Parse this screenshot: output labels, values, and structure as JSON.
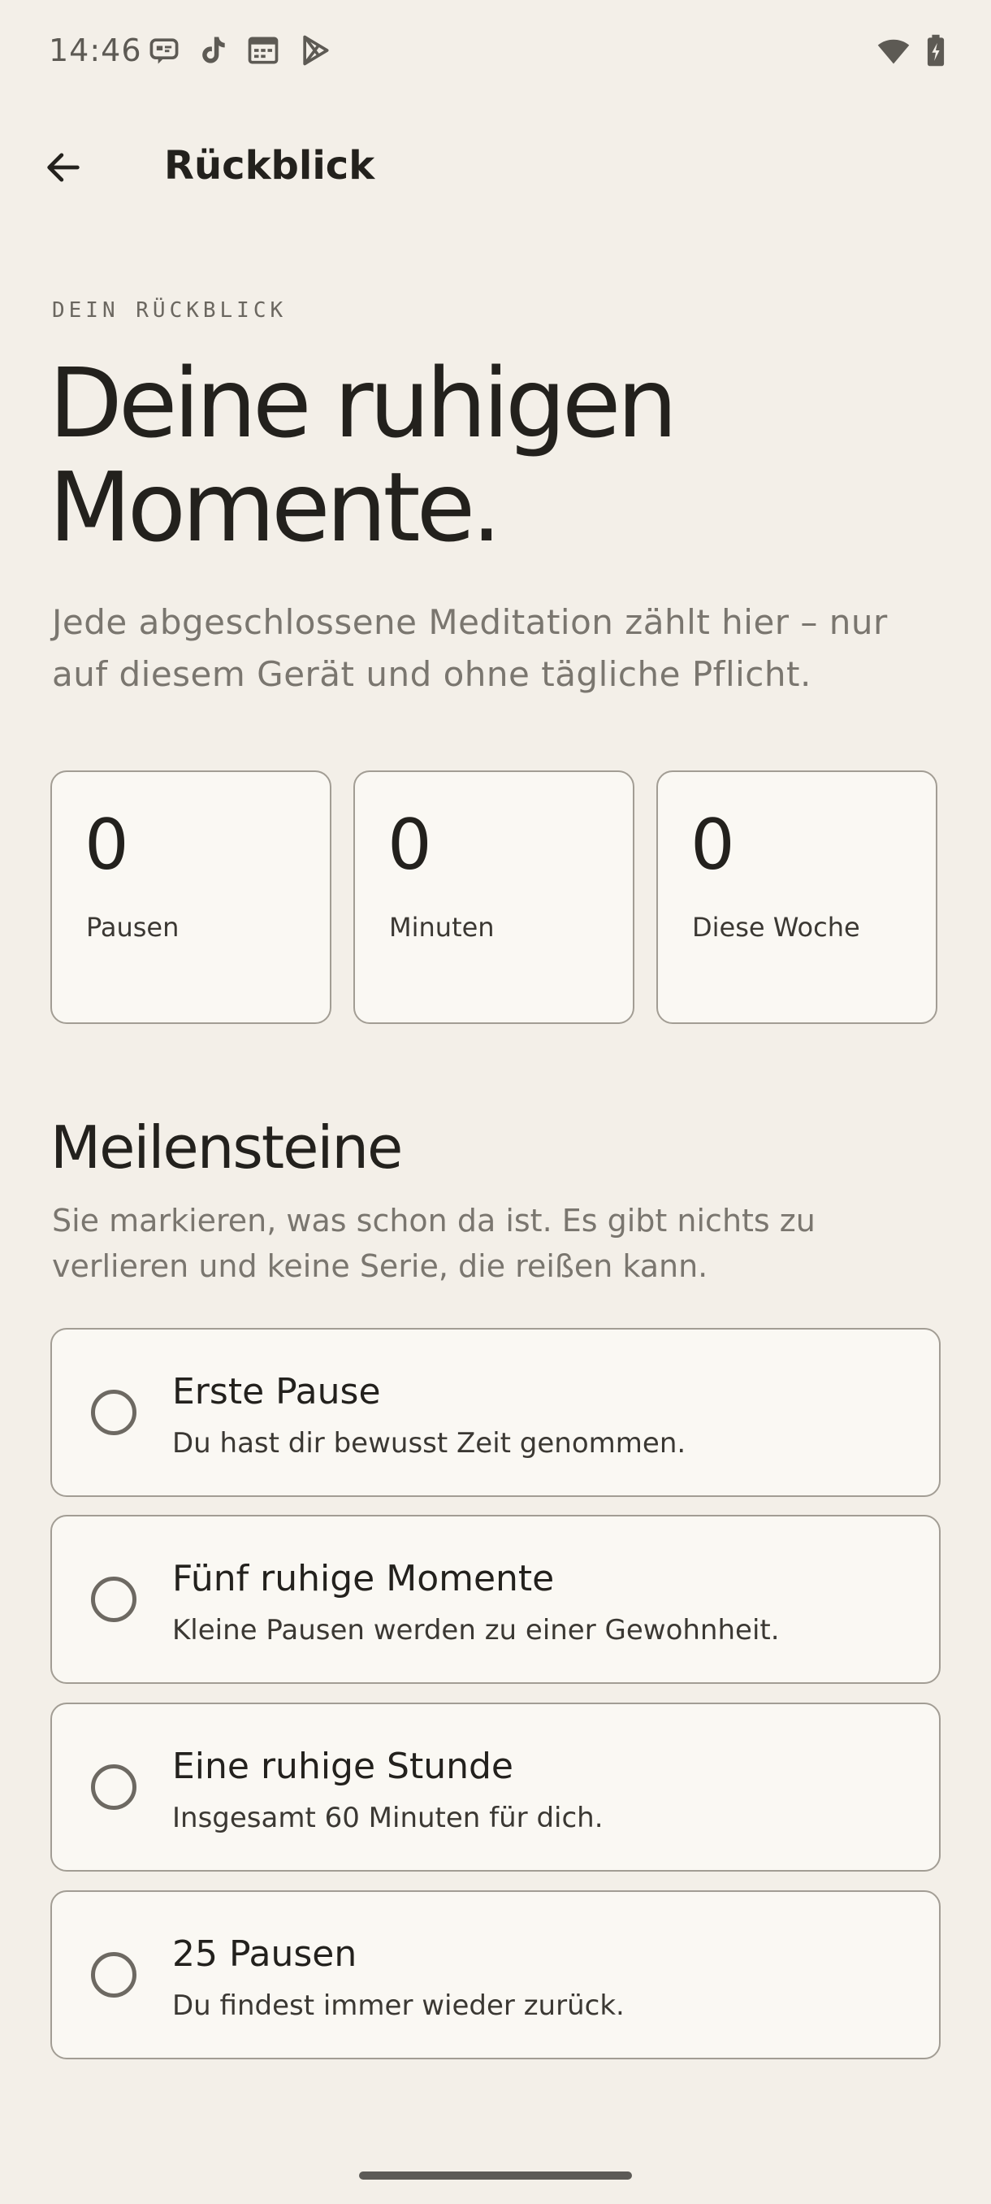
{
  "status_bar": {
    "time": "14:46",
    "notification_icons": [
      "message-icon",
      "tiktok-icon",
      "calendar-icon",
      "play-store-icon"
    ],
    "system_icons": [
      "wifi-icon",
      "battery-charging-icon"
    ]
  },
  "app_bar": {
    "back_icon": "arrow-left-icon",
    "title": "Rückblick"
  },
  "hero": {
    "eyebrow": "DEIN RÜCKBLICK",
    "headline_line1": "Deine ruhigen",
    "headline_line2": "Momente.",
    "intro": "Jede abgeschlossene Meditation zählt hier – nur auf diesem Gerät und ohne tägliche Pflicht."
  },
  "stats": [
    {
      "value": "0",
      "label": "Pausen"
    },
    {
      "value": "0",
      "label": "Minuten"
    },
    {
      "value": "0",
      "label": "Diese Woche"
    }
  ],
  "milestones": {
    "title": "Meilensteine",
    "subtitle": "Sie markieren, was schon da ist. Es gibt nichts zu verlieren und keine Serie, die reißen kann.",
    "items": [
      {
        "title": "Erste Pause",
        "description": "Du hast dir bewusst Zeit genommen.",
        "achieved": false
      },
      {
        "title": "Fünf ruhige Momente",
        "description": "Kleine Pausen werden zu einer Gewohnheit.",
        "achieved": false
      },
      {
        "title": "Eine ruhige Stunde",
        "description": "Insgesamt 60 Minuten für dich.",
        "achieved": false
      },
      {
        "title": "25 Pausen",
        "description": "Du findest immer wieder zurück.",
        "achieved": false
      }
    ]
  },
  "colors": {
    "background": "#f3efe8",
    "card_background": "#faf8f3",
    "card_border": "#a29d94",
    "text_primary": "#23211d",
    "text_secondary": "#7a766f"
  }
}
